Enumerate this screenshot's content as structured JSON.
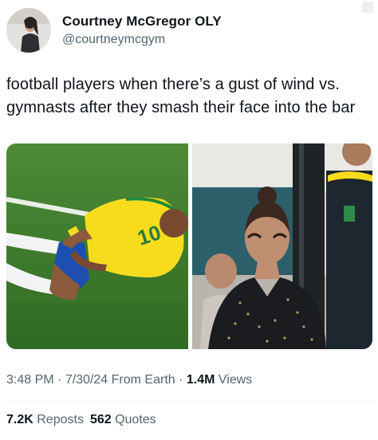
{
  "author": {
    "display_name": "Courtney McGregor OLY",
    "handle": "@courtneymcgym",
    "avatar_icon": "profile-photo"
  },
  "tweet": {
    "line1": "football players when there’s a gust of wind vs.",
    "line2": "gymnasts after they smash their face into the bar"
  },
  "media": {
    "left_jersey_number": "10",
    "left_image_desc_icon": "football-player-photo",
    "right_image_desc_icon": "gymnast-photo"
  },
  "meta": {
    "time": "3:48 PM",
    "sep1": " · ",
    "date": "7/30/24",
    "source": " From Earth",
    "sep2": " · ",
    "views_count": "1.4M",
    "views_label": " Views"
  },
  "stats": {
    "reposts_count": "7.2K",
    "reposts_label": " Reposts",
    "quotes_count": "562",
    "quotes_label": " Quotes"
  },
  "colors": {
    "text": "#0f1419",
    "secondary": "#536471",
    "brazil_yellow": "#f7dc1e",
    "brazil_blue": "#1d4fb0",
    "grass": "#3e7a2c"
  }
}
